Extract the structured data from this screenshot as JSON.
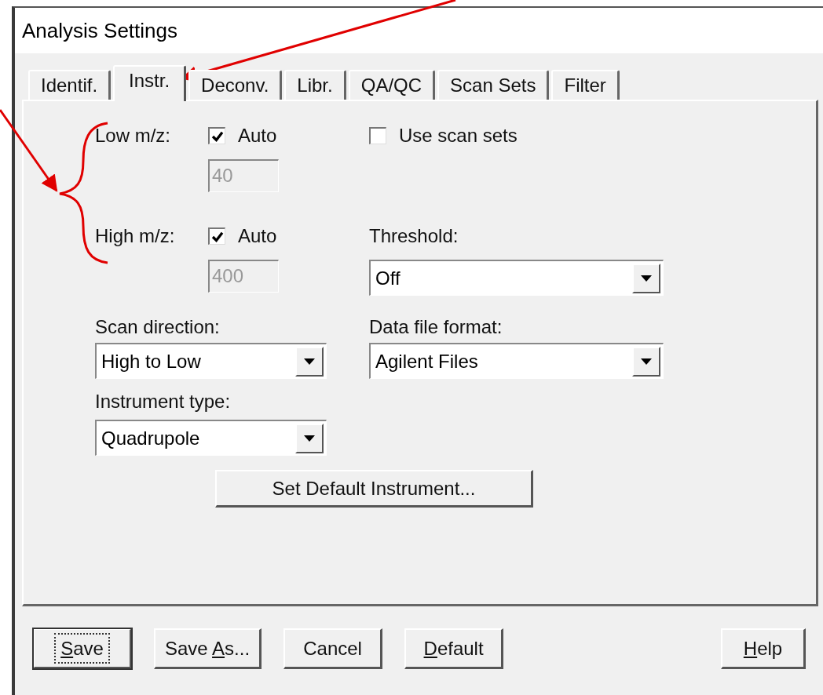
{
  "window": {
    "title": "Analysis Settings"
  },
  "tabs": [
    {
      "label": "Identif.",
      "selected": false
    },
    {
      "label": "Instr.",
      "selected": true
    },
    {
      "label": "Deconv.",
      "selected": false
    },
    {
      "label": "Libr.",
      "selected": false
    },
    {
      "label": "QA/QC",
      "selected": false
    },
    {
      "label": "Scan Sets",
      "selected": false
    },
    {
      "label": "Filter",
      "selected": false
    }
  ],
  "mass_range": [
    {
      "label": "Low m/z:",
      "auto_label": "Auto",
      "auto_checked": true,
      "value": "40",
      "disabled": true
    },
    {
      "label": "High m/z:",
      "auto_label": "Auto",
      "auto_checked": true,
      "value": "400",
      "disabled": true
    }
  ],
  "use_scan_sets": {
    "label": "Use scan sets",
    "checked": false
  },
  "threshold": {
    "label": "Threshold:",
    "value": "Off"
  },
  "scan_direction": {
    "label": "Scan direction:",
    "value": "High to Low"
  },
  "data_file_format": {
    "label": "Data file format:",
    "value": "Agilent Files"
  },
  "instrument_type": {
    "label": "Instrument type:",
    "value": "Quadrupole"
  },
  "set_default_instrument": "Set Default Instrument...",
  "buttons": [
    {
      "key": "S",
      "after": "ave",
      "default": true
    },
    {
      "before": "Save ",
      "key": "A",
      "after": "s...",
      "default": false
    },
    {
      "before": "Cancel",
      "default": false
    },
    {
      "key": "D",
      "after": "efault",
      "default": false
    },
    {
      "key": "H",
      "after": "elp",
      "default": false
    }
  ]
}
